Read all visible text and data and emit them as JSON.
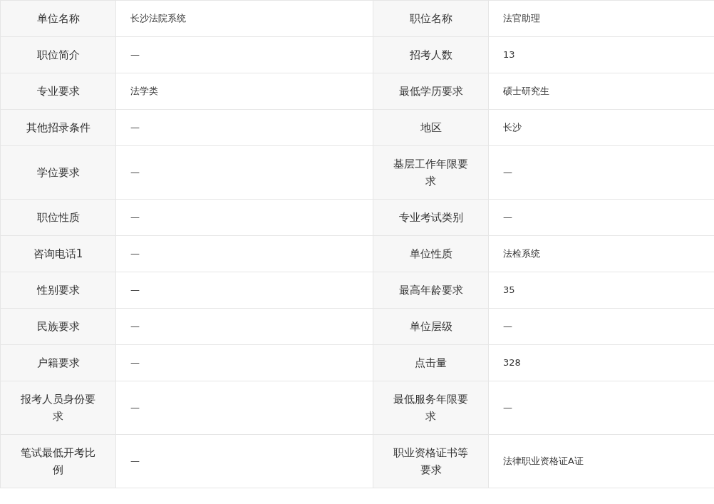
{
  "rows": [
    {
      "label_1": "单位名称",
      "value_1": "长沙法院系统",
      "label_2": "职位名称",
      "value_2": "法官助理"
    },
    {
      "label_1": "职位简介",
      "value_1": "—",
      "label_2": "招考人数",
      "value_2": "13"
    },
    {
      "label_1": "专业要求",
      "value_1": "法学类",
      "label_2": "最低学历要求",
      "value_2": "硕士研究生"
    },
    {
      "label_1": "其他招录条件",
      "value_1": "—",
      "label_2": "地区",
      "value_2": "长沙"
    },
    {
      "label_1": "学位要求",
      "value_1": "—",
      "label_2": "基层工作年限要求",
      "value_2": "—"
    },
    {
      "label_1": "职位性质",
      "value_1": "—",
      "label_2": "专业考试类别",
      "value_2": "—"
    },
    {
      "label_1": "咨询电话1",
      "value_1": "—",
      "label_2": "单位性质",
      "value_2": "法检系统"
    },
    {
      "label_1": "性别要求",
      "value_1": "—",
      "label_2": "最高年龄要求",
      "value_2": "35"
    },
    {
      "label_1": "民族要求",
      "value_1": "—",
      "label_2": "单位层级",
      "value_2": "—"
    },
    {
      "label_1": "户籍要求",
      "value_1": "—",
      "label_2": "点击量",
      "value_2": "328"
    },
    {
      "label_1": "报考人员身份要求",
      "value_1": "—",
      "label_2": "最低服务年限要求",
      "value_2": "—"
    },
    {
      "label_1": "笔试最低开考比例",
      "value_1": "—",
      "label_2": "职业资格证书等要求",
      "value_2": "法律职业资格证A证"
    }
  ]
}
